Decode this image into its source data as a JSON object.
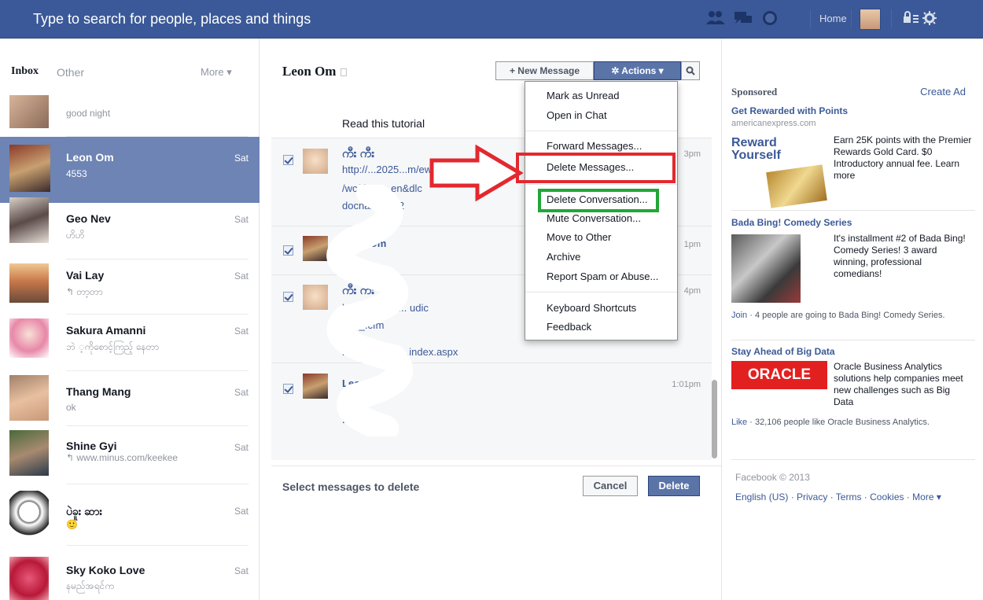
{
  "topbar": {
    "search_placeholder": "Type to search for people, places and things",
    "home_label": "Home",
    "icons": [
      "friends-icon",
      "messages-icon",
      "notifications-icon",
      "privacy-icon",
      "settings-icon"
    ]
  },
  "inbox": {
    "tab_inbox": "Inbox",
    "tab_other": "Other",
    "more_label": "More ▾",
    "conversations": [
      {
        "name": "",
        "snippet": "good night",
        "date": ""
      },
      {
        "name": "Leon Om",
        "snippet": "4553",
        "date": "Sat"
      },
      {
        "name": "Geo Nev",
        "snippet": "ဟိဟိ",
        "date": "Sat"
      },
      {
        "name": "Vai Lay",
        "snippet": "↰ တာ့တာ",
        "date": "Sat"
      },
      {
        "name": "Sakura Amanni",
        "snippet": "ဘဲ ့ကိုစောင့်ကြည့် နေတာ",
        "date": "Sat"
      },
      {
        "name": "Thang Mang",
        "snippet": "ok",
        "date": "Sat"
      },
      {
        "name": "Shine Gyi",
        "snippet": "↰ www.minus.com/keekee",
        "date": "Sat"
      },
      {
        "name": "ပဲခူး ဆား",
        "snippet": "🙂",
        "date": "Sat"
      },
      {
        "name": "Sky Koko Love",
        "snippet": "နမည်အရင်က",
        "date": "Sat"
      }
    ]
  },
  "thread": {
    "title": "Leon Om",
    "new_message": "+ New Message",
    "actions": "✲ Actions ▾",
    "search_icon": "search-icon",
    "read_tutorial": "Read this tutorial",
    "messages": [
      {
        "sender": "ကီး ကီး",
        "lines": [
          "http://...2025...m/ew",
          "/wc/docu...en&dlc",
          "docname=...2"
        ],
        "time": "3pm"
      },
      {
        "sender": "Leon Om",
        "lines": [
          "...."
        ],
        "time": "1pm"
      },
      {
        "sender": "ကီး ကီး",
        "lines": [
          "ht...//xpur/ve... udic",
          "/_..._.cfm",
          "htt...ver.com/...index.aspx"
        ],
        "time": "4pm"
      },
      {
        "sender": "Leon Om",
        "lines": [
          "...",
          "..."
        ],
        "time": "1:01pm"
      }
    ],
    "select_label": "Select messages to delete",
    "cancel": "Cancel",
    "delete": "Delete"
  },
  "actions_menu": {
    "items": [
      "Mark as Unread",
      "Open in Chat",
      "Forward Messages...",
      "Delete Messages...",
      "Delete Conversation...",
      "Mute Conversation...",
      "Move to Other",
      "Archive",
      "Report Spam or Abuse...",
      "Keyboard Shortcuts",
      "Feedback"
    ]
  },
  "sidebar": {
    "sponsored": "Sponsored",
    "create_ad": "Create Ad",
    "ads": [
      {
        "title": "Get Rewarded with Points",
        "url": "americanexpress.com",
        "image_text": "Reward Yourself",
        "body": "Earn 25K points with the Premier Rewards Gold Card. $0 Introductory annual fee. Learn more"
      },
      {
        "title": "Bada Bing! Comedy Series",
        "body": "It's installment #2 of Bada Bing! Comedy Series! 3 award winning, professional comedians!",
        "social_action": "Join",
        "social": "· 4 people are going to Bada Bing! Comedy Series."
      },
      {
        "title": "Stay Ahead of Big Data",
        "image_text": "ORACLE",
        "body": "Oracle Business Analytics solutions help companies meet new challenges such as Big Data",
        "social_action": "Like",
        "social": "· 32,106 people like Oracle Business Analytics."
      }
    ],
    "footer_copy": "Facebook © 2013",
    "footer_links": "English (US) · Privacy · Terms · Cookies · More ▾"
  },
  "colors": {
    "brand": "#3b5998",
    "highlight_red": "#e3282e",
    "highlight_green": "#22a637"
  }
}
